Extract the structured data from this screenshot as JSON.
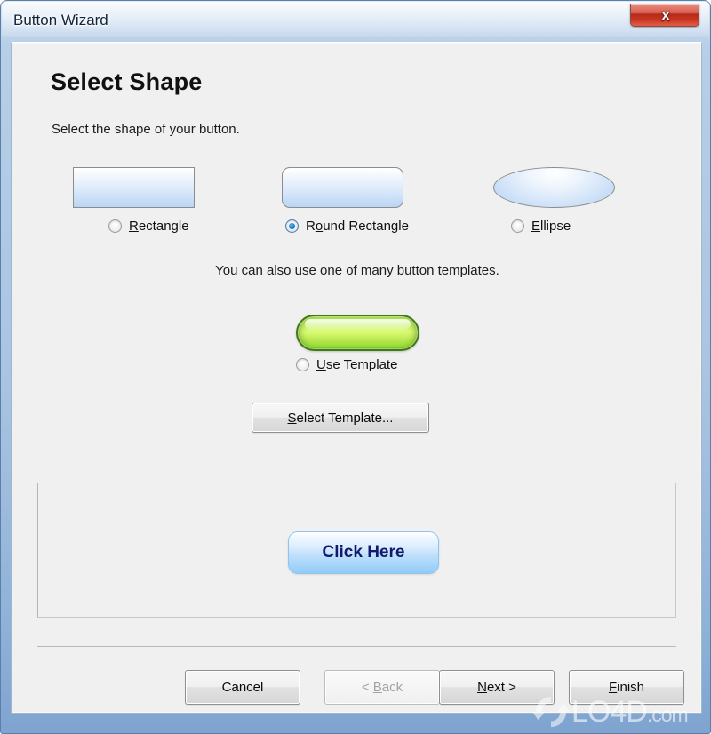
{
  "window": {
    "title": "Button Wizard",
    "close_label": "X",
    "accent_close": "#c9361f",
    "frame_color": "#a9c4e2"
  },
  "page": {
    "title": "Select Shape",
    "subtitle": "Select the shape of your button.",
    "template_hint": "You can also use one of many button templates."
  },
  "shapes": [
    {
      "label_pre": "",
      "label_accel": "R",
      "label_post": "ectangle",
      "shape": "rectangle",
      "selected": false
    },
    {
      "label_pre": "R",
      "label_accel": "o",
      "label_post": "und Rectangle",
      "shape": "round-rectangle",
      "selected": true
    },
    {
      "label_pre": "",
      "label_accel": "E",
      "label_post": "llipse",
      "shape": "ellipse",
      "selected": false
    }
  ],
  "template": {
    "radio_pre": "",
    "radio_accel": "U",
    "radio_post": "se Template",
    "selected": false,
    "button_pre": "",
    "button_accel": "S",
    "button_post": "elect Template...",
    "preview_color": "#bff05c",
    "preview_border_color": "#3f7a16"
  },
  "preview": {
    "button_label": "Click Here",
    "button_text_color": "#121a6e",
    "button_fill_color": "#bfe0fb"
  },
  "footer": {
    "cancel": "Cancel",
    "back_pre": "< ",
    "back_accel": "B",
    "back_post": "ack",
    "back_disabled": true,
    "next_pre": "",
    "next_accel": "N",
    "next_post": "ext >",
    "finish_pre": "",
    "finish_accel": "F",
    "finish_post": "inish"
  },
  "watermark": {
    "text": "LO4D",
    "suffix": ".com"
  }
}
